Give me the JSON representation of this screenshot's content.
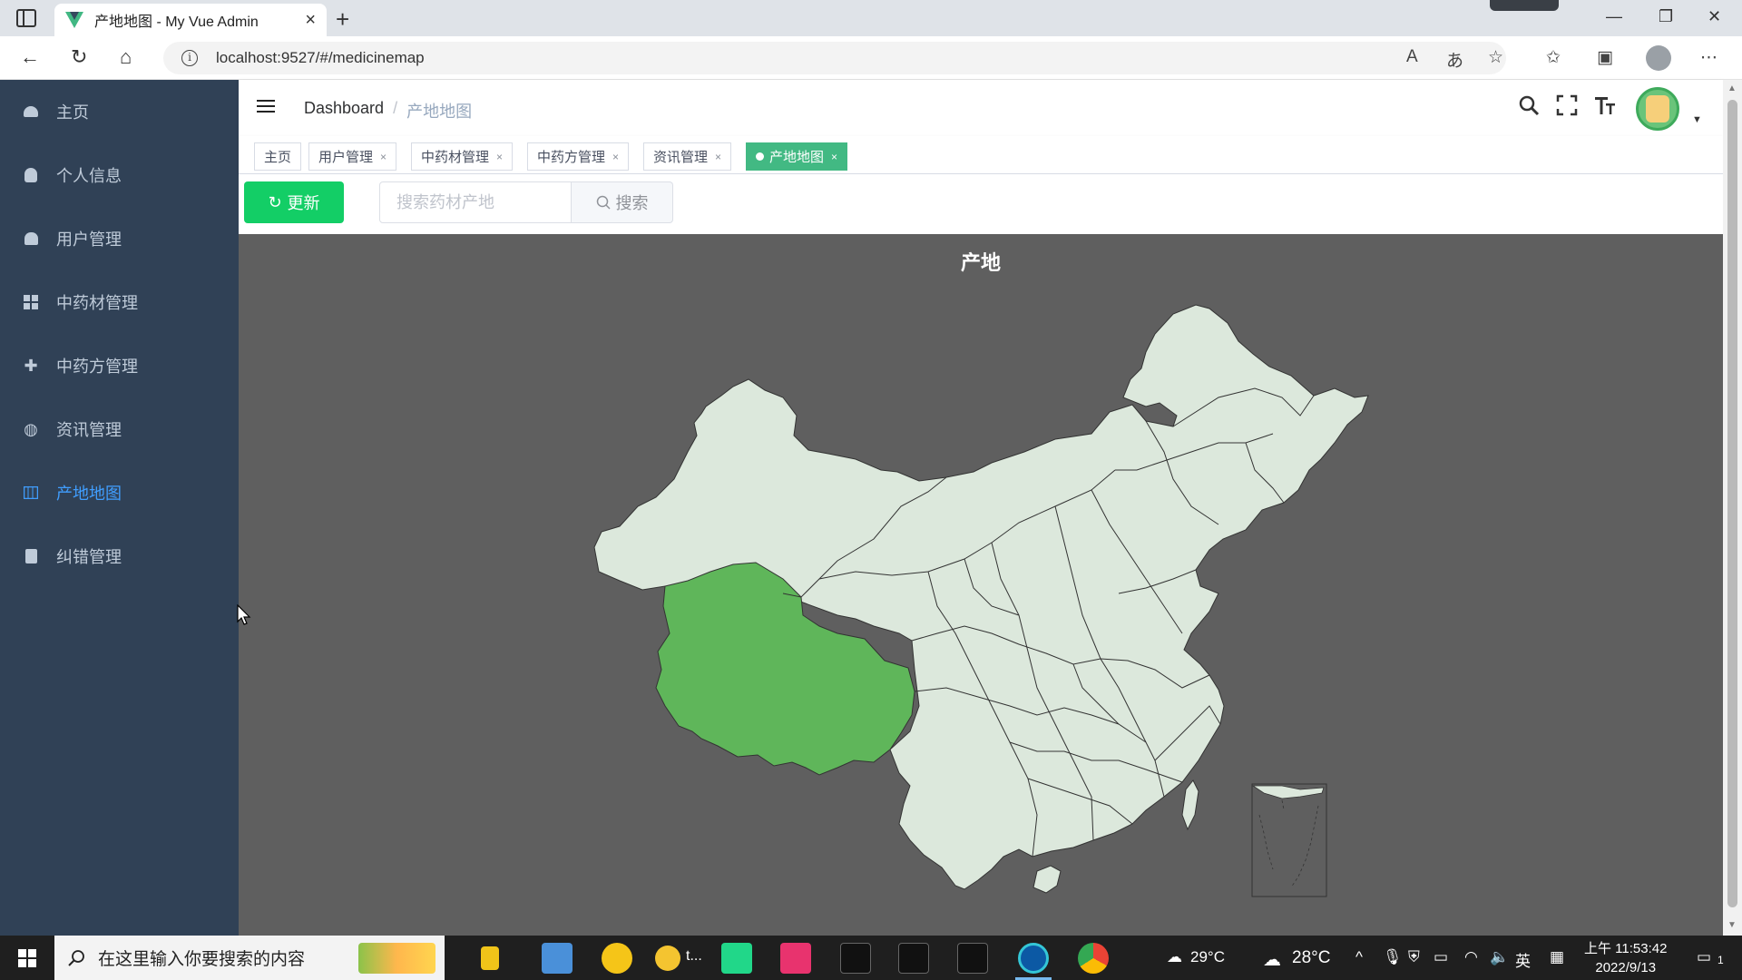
{
  "browser": {
    "tab_title": "产地地图 - My Vue Admin",
    "url": "localhost:9527/#/medicinemap"
  },
  "sidebar": {
    "items": [
      {
        "label": "主页",
        "icon": "dashboard-icon"
      },
      {
        "label": "个人信息",
        "icon": "user-icon"
      },
      {
        "label": "用户管理",
        "icon": "users-icon"
      },
      {
        "label": "中药材管理",
        "icon": "grid-icon"
      },
      {
        "label": "中药方管理",
        "icon": "move-icon"
      },
      {
        "label": "资讯管理",
        "icon": "globe-icon"
      },
      {
        "label": "产地地图",
        "icon": "map-icon",
        "active": true
      },
      {
        "label": "纠错管理",
        "icon": "edit-doc-icon"
      }
    ]
  },
  "navbar": {
    "breadcrumb_home": "Dashboard",
    "breadcrumb_sep": "/",
    "breadcrumb_current": "产地地图"
  },
  "tags": [
    {
      "label": "主页",
      "closable": false
    },
    {
      "label": "用户管理",
      "closable": true
    },
    {
      "label": "中药材管理",
      "closable": true
    },
    {
      "label": "中药方管理",
      "closable": true
    },
    {
      "label": "资讯管理",
      "closable": true
    },
    {
      "label": "产地地图",
      "closable": true,
      "active": true
    }
  ],
  "toolbar": {
    "refresh_label": "更新",
    "search_placeholder": "搜索药材产地",
    "search_label": "搜索"
  },
  "map": {
    "title": "产地",
    "highlighted_region": "西藏",
    "colors": {
      "background": "#5f5f5f",
      "region_fill": "#dce8dc",
      "highlight_fill": "#5fb65a",
      "border": "#333333"
    }
  },
  "taskbar": {
    "search_placeholder": "在这里输入你要搜索的内容",
    "weather_1": "29°C",
    "weather_2": "28°C",
    "ime": "英",
    "time": "上午 11:53:42",
    "date": "2022/9/13",
    "notification_count": "1"
  }
}
